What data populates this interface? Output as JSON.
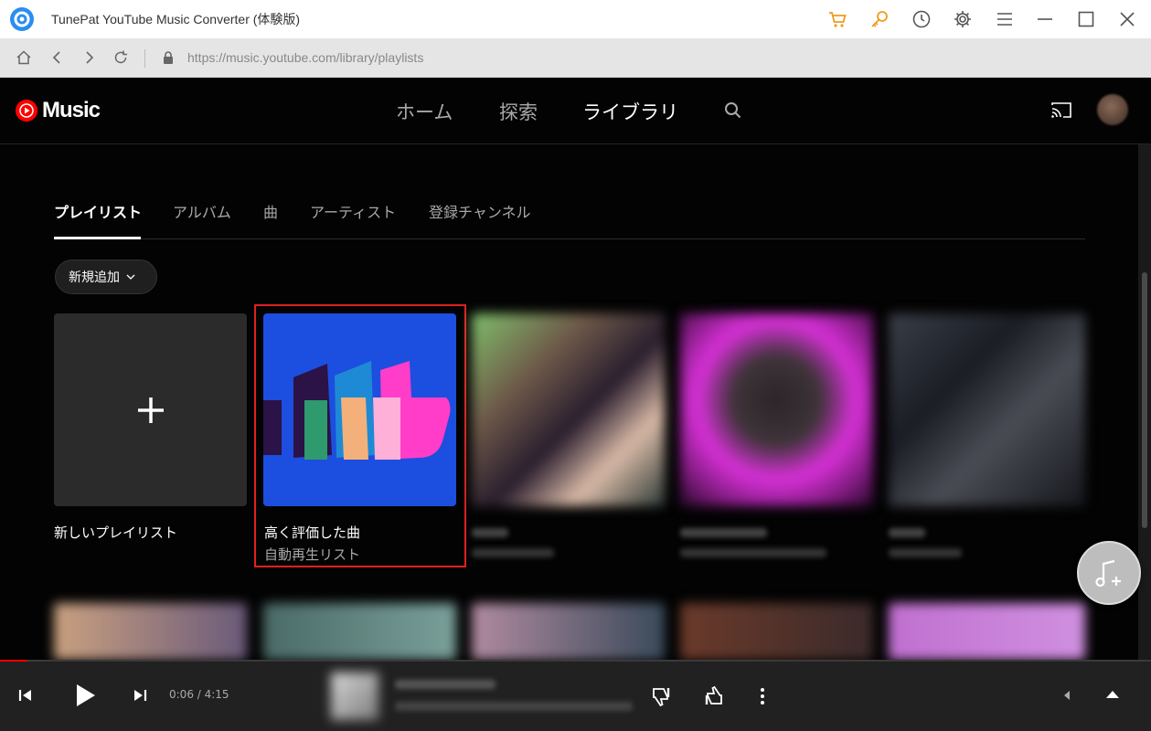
{
  "app": {
    "title": "TunePat YouTube Music Converter (体験版)"
  },
  "address": {
    "url": "https://music.youtube.com/library/playlists"
  },
  "yt": {
    "logo_text": "Music",
    "nav": [
      "ホーム",
      "探索",
      "ライブラリ"
    ]
  },
  "tabs": [
    "プレイリスト",
    "アルバム",
    "曲",
    "アーティスト",
    "登録チャンネル"
  ],
  "new_add_label": "新規追加",
  "cards": [
    {
      "title": "新しいプレイリスト",
      "subtitle": ""
    },
    {
      "title": "高く評価した曲",
      "subtitle": "自動再生リスト"
    }
  ],
  "player": {
    "time": "0:06 / 4:15",
    "progress": 0.024
  },
  "colors": {
    "highlight": "#e02020",
    "accent": "#ff0000",
    "liked_bg": "#1c4ee0"
  }
}
